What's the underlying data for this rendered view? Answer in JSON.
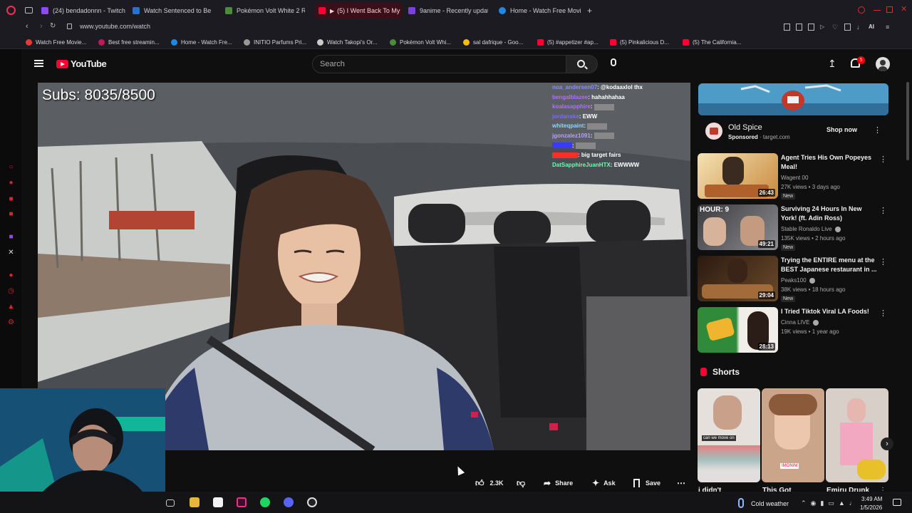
{
  "browser": {
    "tabs": [
      {
        "label": "(24) bendadonnn - Twitch",
        "color": "#9146ff"
      },
      {
        "label": "Watch Sentenced to Be a",
        "color": "#2a6fd6"
      },
      {
        "label": "Pokémon Volt White 2 Re",
        "color": "#4a8c3a"
      },
      {
        "label": "(5) I Went Back To My",
        "color": "#ff0033"
      },
      {
        "label": "9anime - Recently update",
        "color": "#7b3fe4"
      },
      {
        "label": "Home - Watch Free Movie",
        "color": "#1e88e5"
      }
    ],
    "new_tab_symbol": "+",
    "url": "www.youtube.com/watch",
    "bookmarks": [
      {
        "label": "Watch Free Movie...",
        "color": "#e53935"
      },
      {
        "label": "Best free streamin...",
        "color": "#c2185b"
      },
      {
        "label": "Home - Watch Fre...",
        "color": "#1e88e5"
      },
      {
        "label": "INITIO Parfums Pri...",
        "color": "#999999"
      },
      {
        "label": "Watch Takopi's Or...",
        "color": "#cccccc"
      },
      {
        "label": "Pokémon Volt Whi...",
        "color": "#4a8c3a"
      },
      {
        "label": "sal dafrique - Goo...",
        "color": "#fbbc05"
      },
      {
        "label": "(5) #appetizer #ap...",
        "color": "#ff0033"
      },
      {
        "label": "(5) Pinkalicious D...",
        "color": "#ff0033"
      },
      {
        "label": "(5) The California...",
        "color": "#ff0033"
      }
    ]
  },
  "youtube": {
    "logo_text": "YouTube",
    "search_placeholder": "Search",
    "notification_count": "5"
  },
  "video": {
    "overlay_subs": "Subs: 8035/8500",
    "chat": [
      {
        "user": "noa_andersen07",
        "text": "@kodaaxlol thx",
        "color": "#8a8aff"
      },
      {
        "user": "bengalblazee",
        "text": "hahahhahaa",
        "color": "#b46cff"
      },
      {
        "user": "koalasapphire",
        "text": "",
        "color": "#b46cff"
      },
      {
        "user": "jordanske",
        "text": "EWW",
        "color": "#7a6cff"
      },
      {
        "user": "whiteqpaint",
        "text": "",
        "color": "#8ad8ff"
      },
      {
        "user": "jgonzalez1091",
        "text": "",
        "color": "#b6a0ff"
      },
      {
        "user": "",
        "text": "",
        "color": "#3a3aff"
      },
      {
        "user": "",
        "text": "big target fairs",
        "color": "#ff2a2a"
      },
      {
        "user": "DatSapphireJuanHTX",
        "text": "EWWWW",
        "color": "#6affb0"
      }
    ]
  },
  "ad": {
    "brand": "Old Spice",
    "sponsored": "Sponsored",
    "domain": "target.com",
    "cta": "Shop now"
  },
  "recommendations": [
    {
      "title": "Agent Tries His Own Popeyes Meal!",
      "channel": "Wagent 00",
      "meta": "27K views • 3 days ago",
      "badge": "New",
      "duration": "26:43"
    },
    {
      "title": "Surviving 24 Hours In New York! (ft. Adin Ross)",
      "channel": "Stable Ronaldo Live",
      "meta": "135K views • 2 hours ago",
      "badge": "New",
      "duration": "49:21",
      "thumb_text": "HOUR: 9"
    },
    {
      "title": "Trying the ENTIRE menu at the BEST Japanese restaurant in ...",
      "channel": "Peaks100",
      "meta": "38K views • 18 hours ago",
      "badge": "New",
      "duration": "29:04"
    },
    {
      "title": "I Tried Tiktok Viral LA Foods!",
      "channel": "Cinna LIVE",
      "meta": "19K views • 1 year ago",
      "badge": "",
      "duration": "28:13"
    }
  ],
  "shorts": {
    "heading": "Shorts",
    "items": [
      {
        "title": "i didn't",
        "caption": "can we move on"
      },
      {
        "title": "This Got",
        "caption": "IMONIM"
      },
      {
        "title": "Emiru Drunk",
        "caption": ""
      }
    ]
  },
  "actions": {
    "likes": "2.3K",
    "share": "Share",
    "ask": "Ask",
    "save": "Save"
  },
  "taskbar": {
    "weather": "Cold weather",
    "time": "3:49 AM",
    "date": "1/5/2026"
  },
  "colors": {
    "yt_red": "#ff0033",
    "bg": "#0f0f0f",
    "active_tab": "#3a0f1a"
  }
}
